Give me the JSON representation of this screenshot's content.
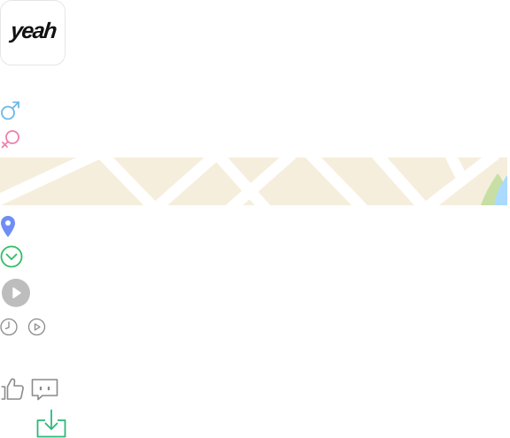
{
  "app": {
    "logo_text": "yeah"
  },
  "icons": {
    "male": "male-symbol-icon",
    "female": "female-symbol-icon",
    "location": "location-pin-icon",
    "expand": "chevron-down-circle-icon",
    "play": "play-circle-icon",
    "clock": "clock-icon",
    "play_small": "play-outline-icon",
    "like": "thumbs-up-icon",
    "comment": "chat-bubble-icon",
    "download": "download-icon"
  },
  "colors": {
    "male": "#6bb8e6",
    "female": "#ef7fae",
    "location": "#6f8df5",
    "expand": "#2fbf63",
    "play_bg": "#bdbdbd",
    "download": "#2db87a",
    "map_land": "#f6eedc",
    "map_road": "#ffffff",
    "map_park": "#c7dfa4",
    "map_water": "#aadaff"
  }
}
